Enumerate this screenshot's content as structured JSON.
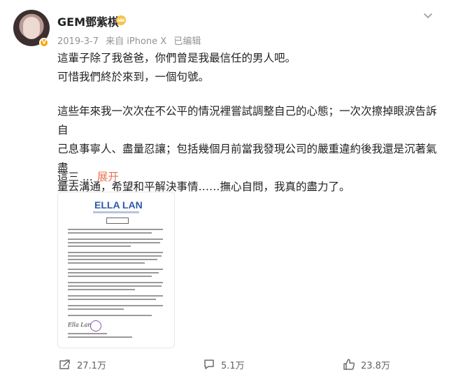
{
  "post": {
    "username": "GEM鄧紫棋",
    "date": "2019-3-7",
    "source": "来自 iPhone X",
    "edited": "已编辑",
    "paragraph1_line1": "這輩子除了我爸爸，你們曾是我最信任的男人吧。",
    "paragraph1_line2": "可惜我們終於來到，一個句號。",
    "paragraph2_line1": "這些年來我一次次在不公平的情況裡嘗試調整自己的心態；一次次擦掉眼淚告訴自",
    "paragraph2_line2": "己息事寧人、盡量忍讓；包括幾個月前當我發現公司的嚴重違約後我還是沉著氣盡",
    "paragraph2_line3": "量去溝通，希望和平解決事情……撫心自問，我真的盡力了。",
    "paragraph3": "這三 ...",
    "expand_label": "展开",
    "document": {
      "logo_text": "ELLA LAN",
      "signature": "Ella Lan"
    }
  },
  "actions": {
    "repost_count": "27.1万",
    "comment_count": "5.1万",
    "like_count": "23.8万"
  },
  "icons": {
    "avatar_badge": "verified-badge",
    "crown": "crown-icon",
    "more": "chevron-down-icon",
    "repost": "share-icon",
    "comment": "comment-icon",
    "like": "thumb-up-icon"
  },
  "colors": {
    "accent": "#eb7350",
    "meta_text": "#939393"
  }
}
